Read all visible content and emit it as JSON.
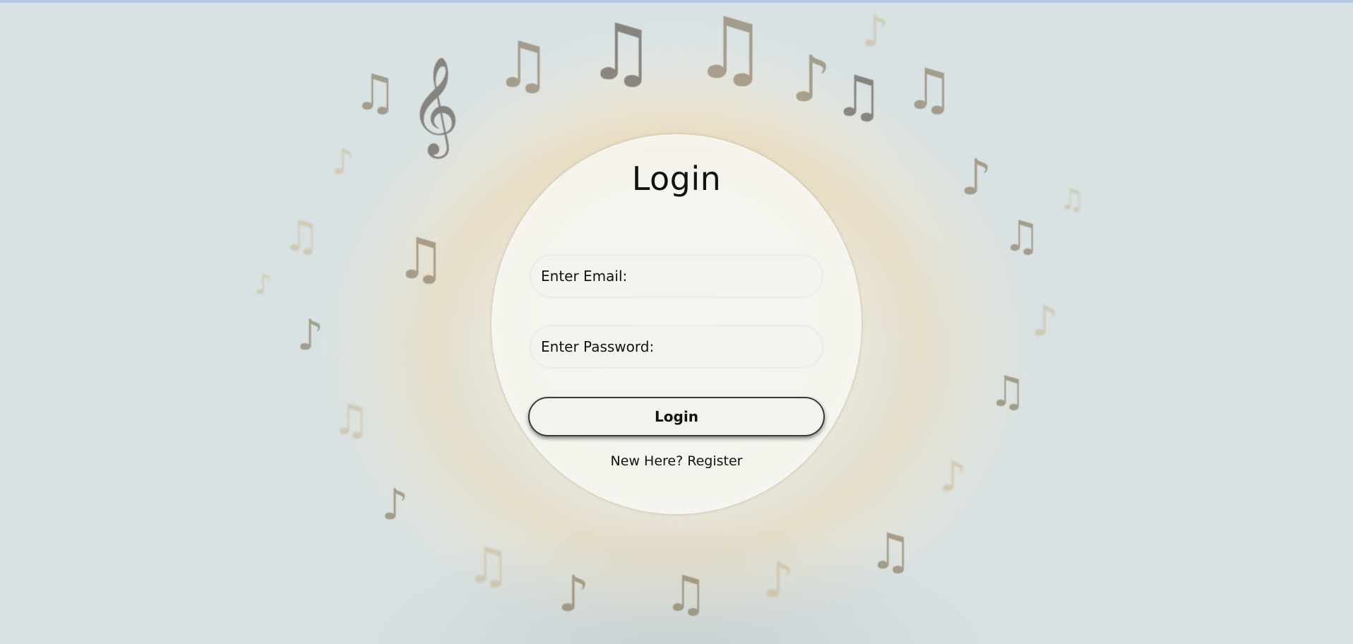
{
  "login": {
    "title": "Login",
    "email_placeholder": "Enter Email:",
    "password_placeholder": "Enter Password:",
    "button_label": "Login",
    "register_prompt": "New Here? ",
    "register_link": "Register"
  }
}
